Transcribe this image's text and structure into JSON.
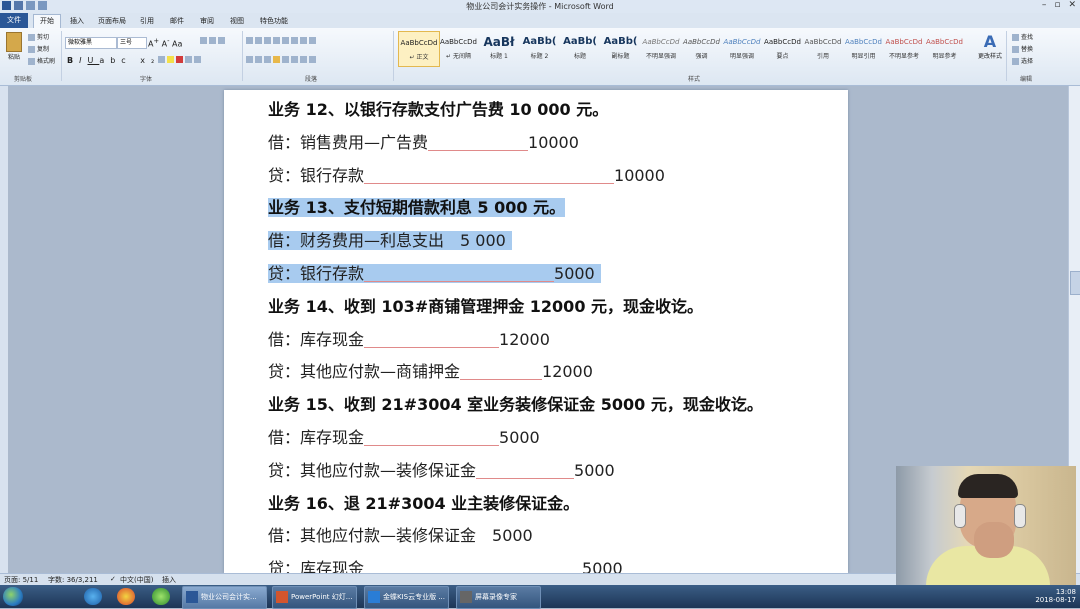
{
  "window": {
    "title": "物业公司会计实务操作 - Microsoft Word"
  },
  "tabs": [
    "文件",
    "开始",
    "插入",
    "页面布局",
    "引用",
    "邮件",
    "审阅",
    "视图",
    "特色功能"
  ],
  "ribbon": {
    "clipboard": {
      "paste": "粘贴",
      "cut": "剪切",
      "copy": "复制",
      "format_painter": "格式刷",
      "label": "剪贴板"
    },
    "font": {
      "name": "微软雅黑",
      "size": "三号",
      "label": "字体"
    },
    "paragraph": {
      "label": "段落"
    },
    "styles": {
      "label": "样式",
      "items": [
        {
          "preview": "AaBbCcDd",
          "name": "↵ 正文"
        },
        {
          "preview": "AaBbCcDd",
          "name": "↵ 无间隔"
        },
        {
          "preview": "AaBł",
          "name": "标题 1"
        },
        {
          "preview": "AaBb(",
          "name": "标题 2"
        },
        {
          "preview": "AaBb(",
          "name": "标题"
        },
        {
          "preview": "AaBb(",
          "name": "副标题"
        },
        {
          "preview": "AaBbCcDd",
          "name": "不明显强调"
        },
        {
          "preview": "AaBbCcDd",
          "name": "强调"
        },
        {
          "preview": "AaBbCcDd",
          "name": "明显强调"
        },
        {
          "preview": "AaBbCcDd",
          "name": "要点"
        },
        {
          "preview": "AaBbCcDd",
          "name": "引用"
        },
        {
          "preview": "AaBbCcDd",
          "name": "明显引用"
        },
        {
          "preview": "AaBbCcDd",
          "name": "不明显参考"
        },
        {
          "preview": "AaBbCcDd",
          "name": "明显参考"
        }
      ],
      "change": "更改样式"
    },
    "editing": {
      "find": "查找",
      "replace": "替换",
      "select": "选择",
      "label": "编辑"
    }
  },
  "document": {
    "lines": [
      {
        "text": "业务 12、以银行存款支付广告费 10 000 元。",
        "bold": true
      },
      {
        "pre": "借：销售费用—广告费",
        "amt": "10000",
        "gap": 100
      },
      {
        "pre": "贷：银行存款",
        "amt": "10000",
        "gap": 250
      },
      {
        "text": "业务 13、支付短期借款利息 5 000 元。",
        "bold": true,
        "hl": true
      },
      {
        "pre": "借：财务费用—利息支出",
        "amt": "5 000",
        "gap": 0,
        "hl": true,
        "plain": true
      },
      {
        "pre": "贷：银行存款",
        "amt": "5000",
        "gap": 190,
        "hl": true
      },
      {
        "text": "业务 14、收到 103#商铺管理押金 12000 元，现金收讫。",
        "bold": true
      },
      {
        "pre": "借：库存现金",
        "amt": "12000",
        "gap": 135
      },
      {
        "pre": "贷：其他应付款—商铺押金",
        "amt": "12000",
        "gap": 82
      },
      {
        "text": "业务 15、收到 21#3004 室业务装修保证金 5000 元，现金收讫。",
        "bold": true
      },
      {
        "pre": "借：库存现金",
        "amt": "5000",
        "gap": 135
      },
      {
        "pre": "贷：其他应付款—装修保证金",
        "amt": "5000",
        "gap": 98
      },
      {
        "text": "业务 16、退 21#3004 业主装修保证金。",
        "bold": true
      },
      {
        "pre": "借：其他应付款—装修保证金",
        "amt": "5000",
        "gap": 0,
        "plain": true
      },
      {
        "pre": "贷：库存现金",
        "amt": "5000",
        "gap": 218,
        "plain": true
      }
    ]
  },
  "status": {
    "page": "页面: 5/11",
    "words": "字数: 36/3,211",
    "lang": "中文(中国)",
    "insert": "插入"
  },
  "taskbar": {
    "items": [
      "物业公司会计实...",
      "PowerPoint 幻灯...",
      "金蝶KIS云专业版 ...",
      "屏幕录像专家"
    ],
    "time": "13:08",
    "date": "2018-08-17"
  }
}
